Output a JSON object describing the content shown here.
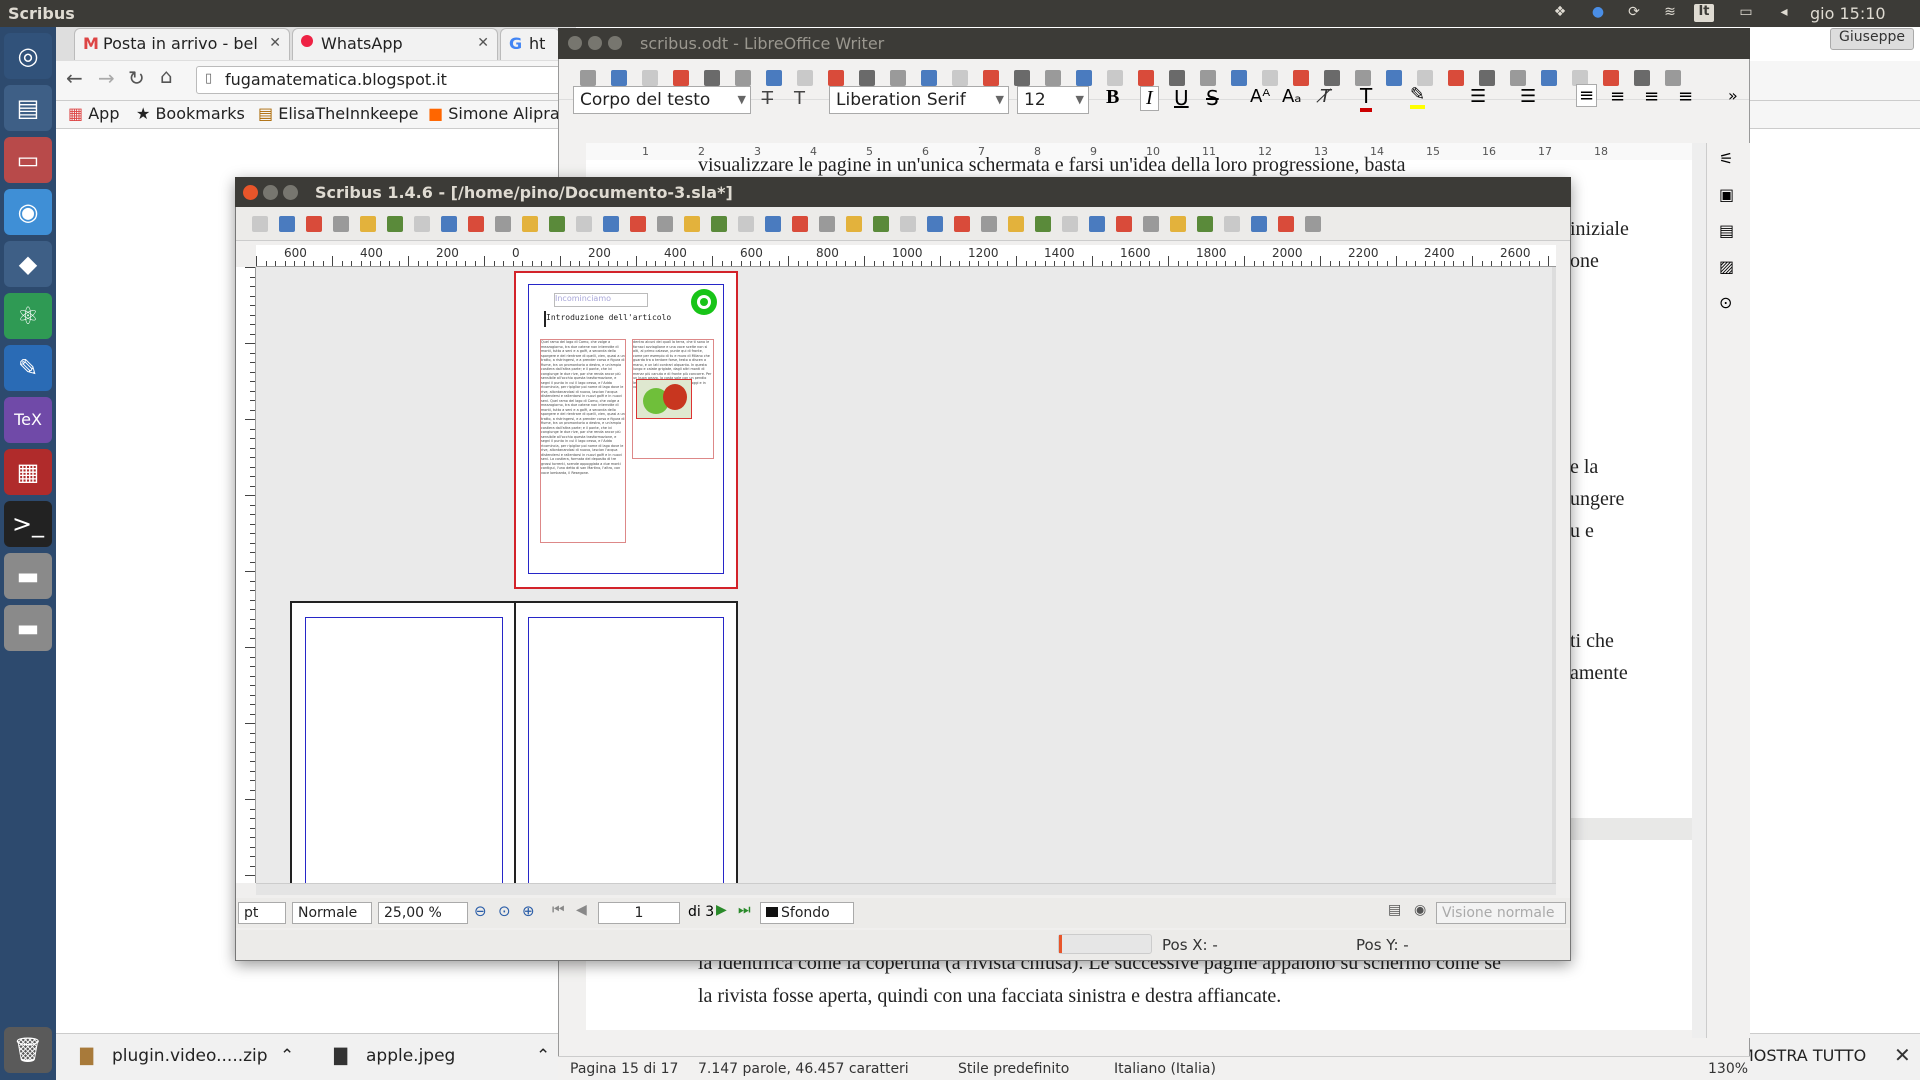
{
  "topbar": {
    "app_name": "Scribus",
    "clock": "gio 15:10",
    "keyboard": "It"
  },
  "chrome": {
    "tabs": [
      {
        "label": "Posta in arrivo - bel",
        "icon": "gmail-icon"
      },
      {
        "label": "WhatsApp",
        "icon": "whatsapp-icon"
      },
      {
        "label": "ht",
        "icon": "google-icon"
      }
    ],
    "url": "fugamatematica.blogspot.it",
    "bookmarks": [
      {
        "label": "App",
        "icon": "apps-grid-icon"
      },
      {
        "label": "Bookmarks",
        "icon": "star-icon"
      },
      {
        "label": "ElisaTheInnkeepe",
        "icon": "bookmark-icon"
      },
      {
        "label": "Simone Aliprai",
        "icon": "blogger-icon"
      }
    ],
    "downloads": [
      {
        "name": "plugin.video.....zip"
      },
      {
        "name": "apple.jpeg"
      }
    ],
    "show_all": "MOSTRA TUTTO",
    "user": "Giuseppe"
  },
  "writer": {
    "title": "scribus.odt - LibreOffice Writer",
    "paragraph_style": "Corpo del testo",
    "font_name": "Liberation Serif",
    "font_size": "12",
    "text_top": "visualizzare le pagine in un'unica schermata e farsi un'idea della loro progressione, basta",
    "right_fragments": [
      "iniziale",
      "one",
      "e la",
      "ungere",
      "u e",
      "ti che",
      "amente"
    ],
    "text_bottom_1": "la identifica come la copertina (a rivista chiusa). Le successive pagine appaiono su schermo come se",
    "text_bottom_2": "la rivista fosse aperta, quindi con una facciata sinistra e destra affiancate.",
    "ruler_nums": [
      "1",
      "2",
      "3",
      "4",
      "5",
      "6",
      "7",
      "8",
      "9",
      "10",
      "11",
      "12",
      "13",
      "14",
      "15",
      "16",
      "17",
      "18"
    ],
    "status": {
      "page": "Pagina 15 di 17",
      "words": "7.147 parole, 46.457 caratteri",
      "style": "Stile predefinito",
      "lang": "Italiano (Italia)",
      "zoom": "130%"
    }
  },
  "scribus": {
    "title": "Scribus 1.4.6 - [/home/pino/Documento-3.sla*]",
    "ruler_labels": [
      "600",
      "400",
      "200",
      "0",
      "200",
      "400",
      "600",
      "800",
      "1000",
      "1200",
      "1400",
      "1600",
      "1800",
      "2000",
      "2200",
      "2400",
      "2600"
    ],
    "page1": {
      "heading": "Incominciamo",
      "subheading": "Introduzione dell'articolo",
      "col1_text": "Quel ramo del lago di Como, che volge a mezzogiorno, tra due catene non interrotte di monti, tutto a seni e a golfi, a seconda dello sporgere e del rientrare di quelli, vien, quasi a un tratto, a ristringersi, e a prender corso e figura di fiume, tra un promontorio a destra, e un'ampia costiera dall'altra parte; e il ponte, che ivi congiunge le due rive, par che renda ancor più sensibile all'occhio questa trasformazione, e segni il punto in cui il lago cessa, e l'Adda ricomincia, per ripigliar poi nome di lago dove le rive, allontanandosi di nuovo, lascian l'acqua distendersi e rallentarsi in nuovi golfi e in nuovi seni. Quel ramo del lago di Como, che volge a mezzogiorno, tra due catene non interrotte di monti, tutto a seni e a golfi, a seconda dello sporgere e del rientrare di quelli, vien, quasi a un tratto, a ristringersi, e a prender corso e figura di fiume, tra un promontorio a destra, e un'ampia costiera dall'altra parte; e il ponte, che ivi congiunge le due rive, par che renda ancor più sensibile all'occhio questa trasformazione, e segni il punto in cui il lago cessa, e l'Adda ricomincia, per ripigliar poi nome di lago dove le rive, allontanandosi di nuovo, lascian l'acqua distendersi e rallentarsi in nuovi golfi e in nuovi seni. La costiera, formata del deposito di tre grossi torrenti, scende appoggiata a due monti contigui, l'uno detto di san Martino, l'altro, con voce lombarda, il Resegone.",
      "col2_text": "dentro alcuni dei quali la terra, che ti sono le fornaci avviaglione e una voce scelte non si alti, al primo calasse, punte qui di fronte, come per esempio di tu e muro di Milano che guarda tra a tentare forse, testo a discen a mano, e un lati contrari alquanto. In questa lungo e calate grigiate, dagli altri monti di menar più canuto e di fronte più concorre. Per un buon pezzo, la costa sale con un pendio lento e continuo; poi si rompe in poggi e in valloncelli, in erte."
    },
    "unit": "pt",
    "mode": "Normale",
    "zoom": "25,00 %",
    "page_num": "1",
    "page_of": "di 3",
    "layer": "Sfondo",
    "view": "Visione normale",
    "pos_x": "Pos X:  -",
    "pos_y": "Pos Y:  -"
  },
  "colors": {
    "ubuntu_panel": "#3c3b37",
    "launcher": "#2d4a6e",
    "page_border_red": "#d3232a",
    "margin_blue": "#2727c8",
    "frame_green": "#18c418"
  }
}
